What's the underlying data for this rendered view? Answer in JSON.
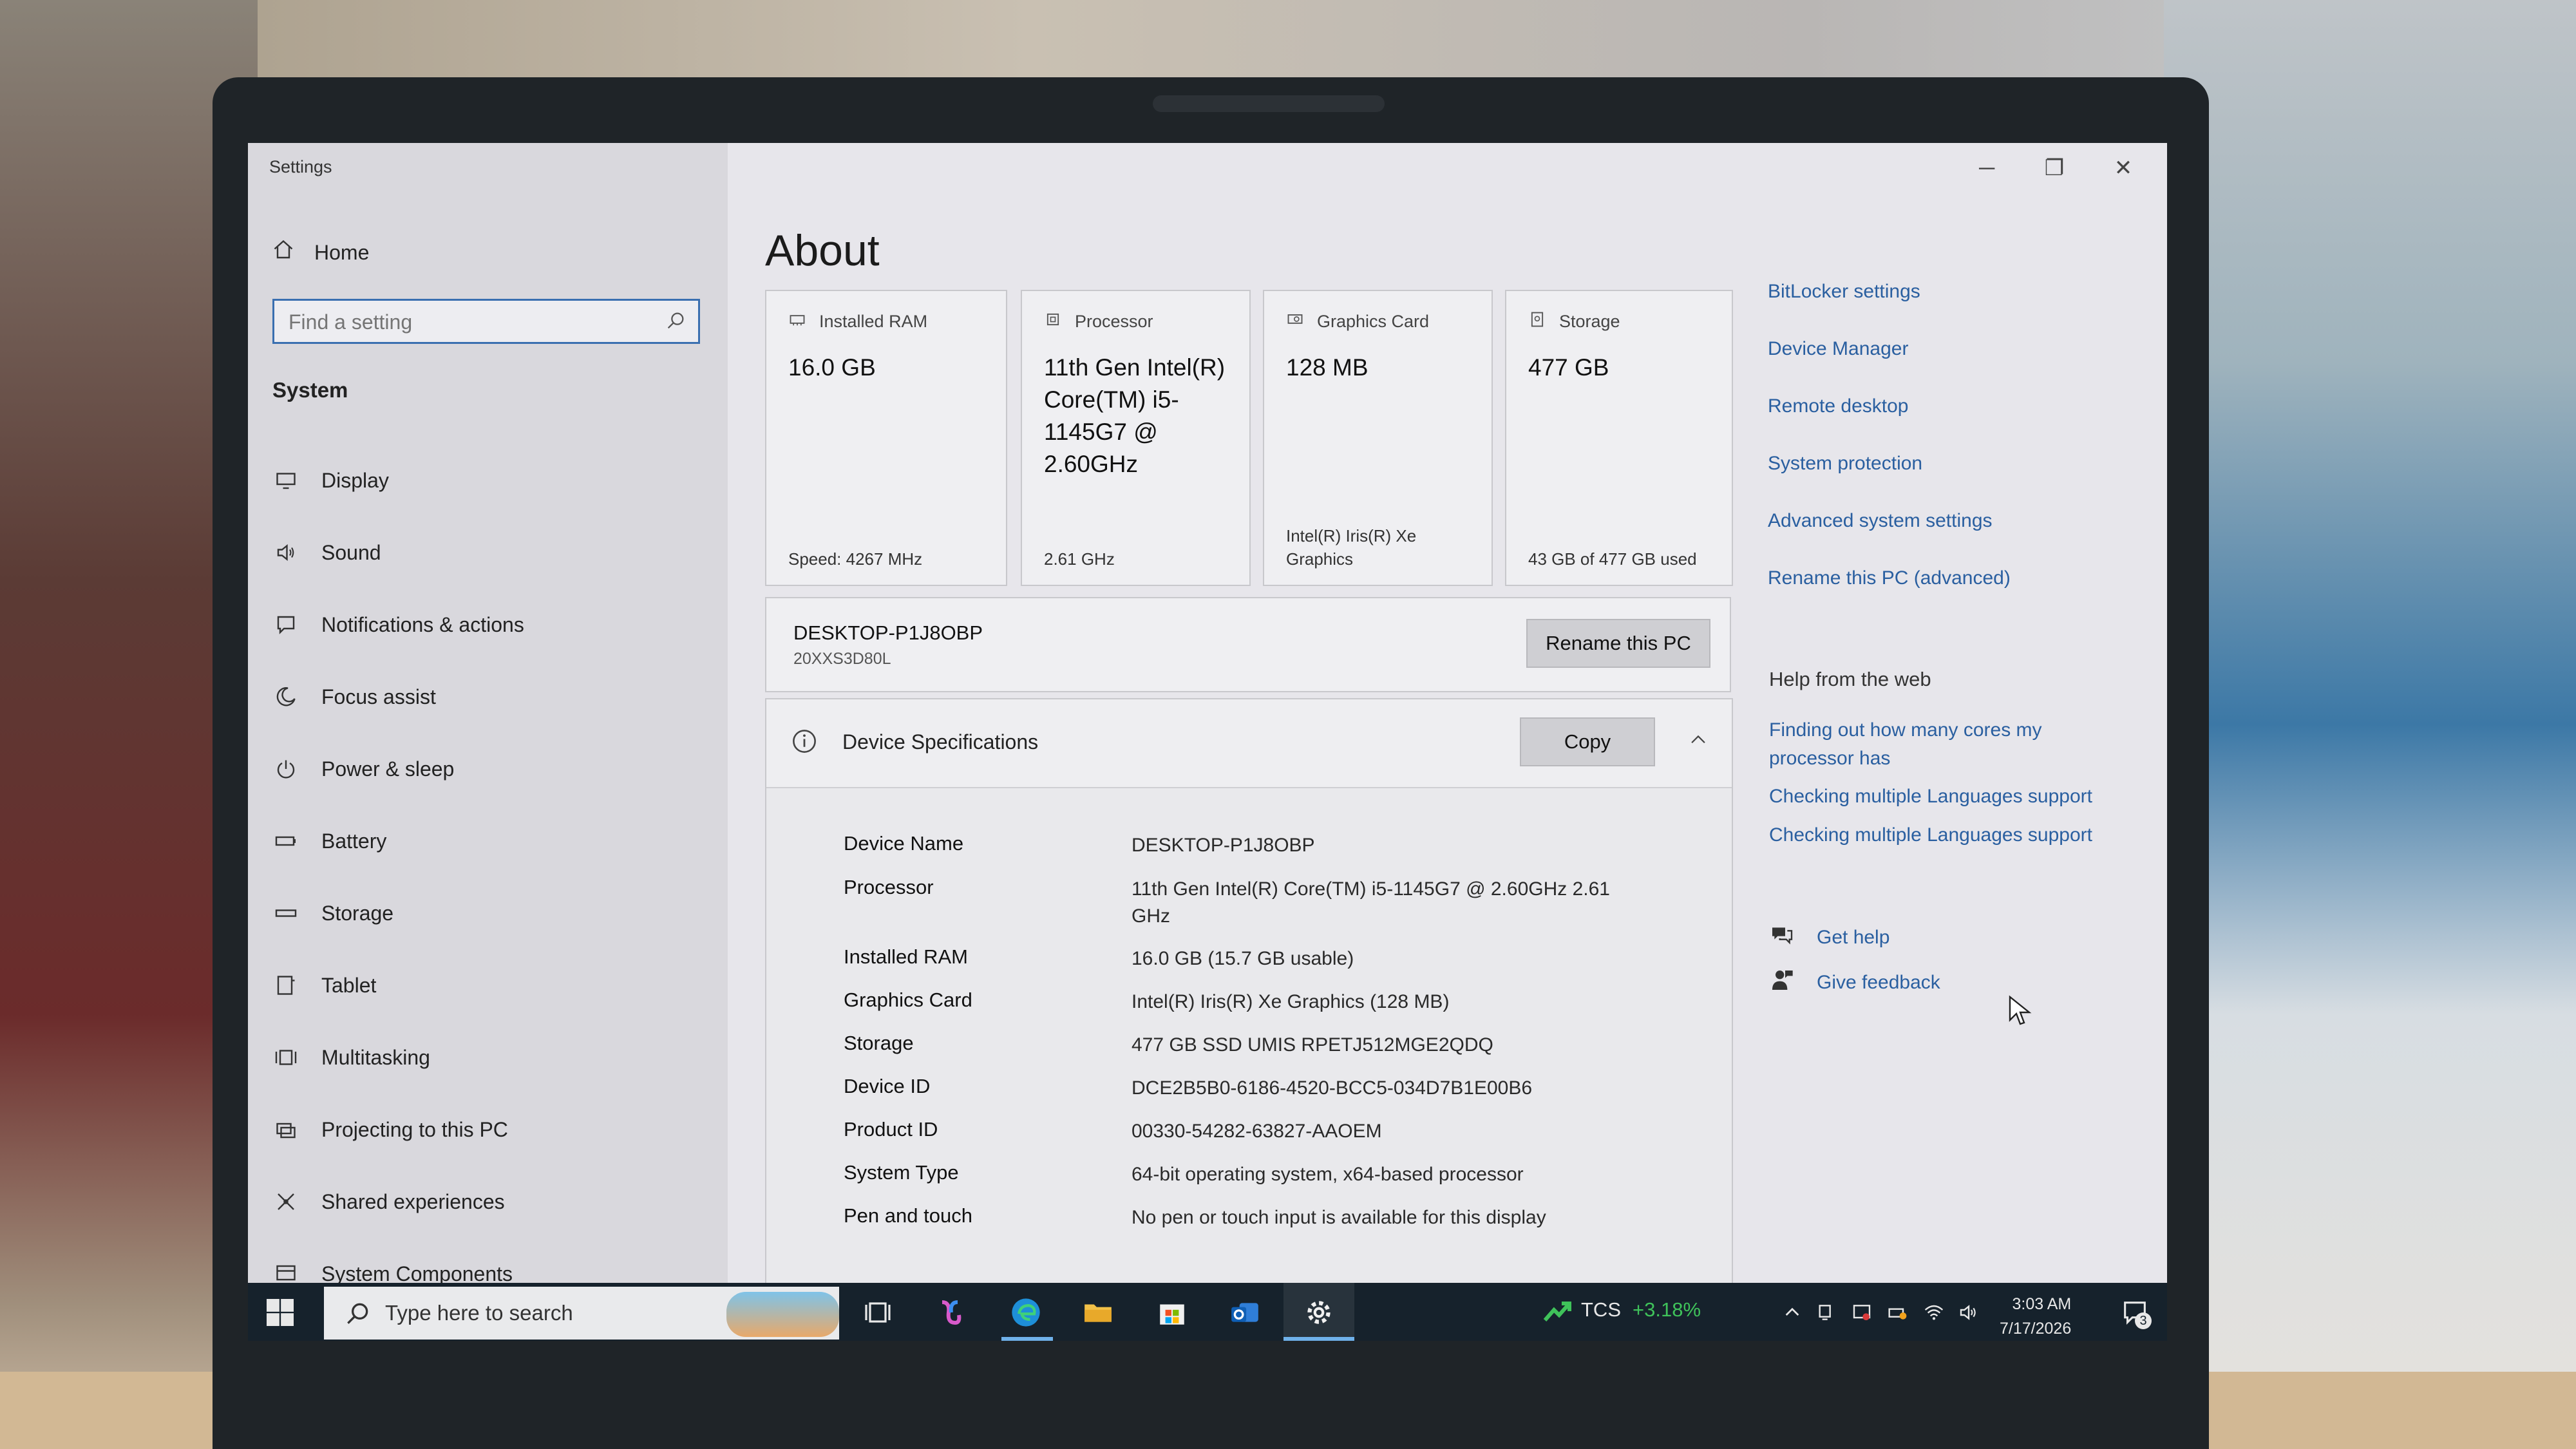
{
  "window": {
    "title": "Settings"
  },
  "nav": {
    "home": "Home",
    "search_placeholder": "Find a setting",
    "section": "System",
    "items": [
      {
        "label": "Display",
        "icon": "monitor-icon"
      },
      {
        "label": "Sound",
        "icon": "speaker-icon"
      },
      {
        "label": "Notifications & actions",
        "icon": "notification-icon"
      },
      {
        "label": "Focus assist",
        "icon": "moon-icon"
      },
      {
        "label": "Power & sleep",
        "icon": "power-icon"
      },
      {
        "label": "Battery",
        "icon": "battery-icon"
      },
      {
        "label": "Storage",
        "icon": "storage-icon"
      },
      {
        "label": "Tablet",
        "icon": "tablet-icon"
      },
      {
        "label": "Multitasking",
        "icon": "multitasking-icon"
      },
      {
        "label": "Projecting to this PC",
        "icon": "projector-icon"
      },
      {
        "label": "Shared experiences",
        "icon": "shared-icon"
      },
      {
        "label": "System Components",
        "icon": "components-icon"
      }
    ]
  },
  "main": {
    "title": "About",
    "cards": [
      {
        "label": "Installed RAM",
        "value": "16.0 GB",
        "sub": "Speed: 4267 MHz",
        "icon": "ram-icon"
      },
      {
        "label": "Processor",
        "value": "11th Gen Intel(R) Core(TM) i5-1145G7 @ 2.60GHz",
        "sub": "2.61 GHz",
        "icon": "cpu-icon"
      },
      {
        "label": "Graphics Card",
        "value": "128 MB",
        "sub": "Intel(R) Iris(R) Xe Graphics",
        "icon": "gpu-icon"
      },
      {
        "label": "Storage",
        "value": "477 GB",
        "sub": "43 GB of 477 GB used",
        "icon": "disk-icon"
      }
    ],
    "pc": {
      "name": "DESKTOP-P1J8OBP",
      "model": "20XXS3D80L",
      "rename_label": "Rename this PC"
    },
    "specs": {
      "title": "Device Specifications",
      "copy_label": "Copy",
      "rows": [
        {
          "key": "Device Name",
          "value": "DESKTOP-P1J8OBP"
        },
        {
          "key": "Processor",
          "value": "11th Gen Intel(R) Core(TM) i5-1145G7 @ 2.60GHz   2.61 GHz"
        },
        {
          "key": "Installed RAM",
          "value": "16.0 GB (15.7 GB usable)"
        },
        {
          "key": "Graphics Card",
          "value": "Intel(R) Iris(R) Xe Graphics (128 MB)"
        },
        {
          "key": "Storage",
          "value": "477 GB SSD UMIS RPETJ512MGE2QDQ"
        },
        {
          "key": "Device ID",
          "value": "DCE2B5B0-6186-4520-BCC5-034D7B1E00B6"
        },
        {
          "key": "Product ID",
          "value": "00330-54282-63827-AAOEM"
        },
        {
          "key": "System Type",
          "value": "64-bit operating system, x64-based processor"
        },
        {
          "key": "Pen and touch",
          "value": "No pen or touch input is available for this display"
        }
      ]
    }
  },
  "related": {
    "links": [
      "BitLocker settings",
      "Device Manager",
      "Remote desktop",
      "System protection",
      "Advanced system settings",
      "Rename this PC (advanced)"
    ],
    "help_heading": "Help from the web",
    "web_links": [
      "Finding out how many cores my processor has",
      "Checking multiple Languages support",
      "Checking multiple Languages support"
    ],
    "get_help": "Get help",
    "give_feedback": "Give feedback"
  },
  "taskbar": {
    "search_placeholder": "Type here to search",
    "stock_symbol": "TCS",
    "stock_change": "+3.18%",
    "time": "3:03 AM",
    "date": "7/17/2026",
    "notification_count": "3"
  },
  "colors": {
    "link": "#2a5fa0",
    "accent": "#3a6fb0",
    "taskbar": "#16222c",
    "stock_up": "#3fc25a"
  }
}
